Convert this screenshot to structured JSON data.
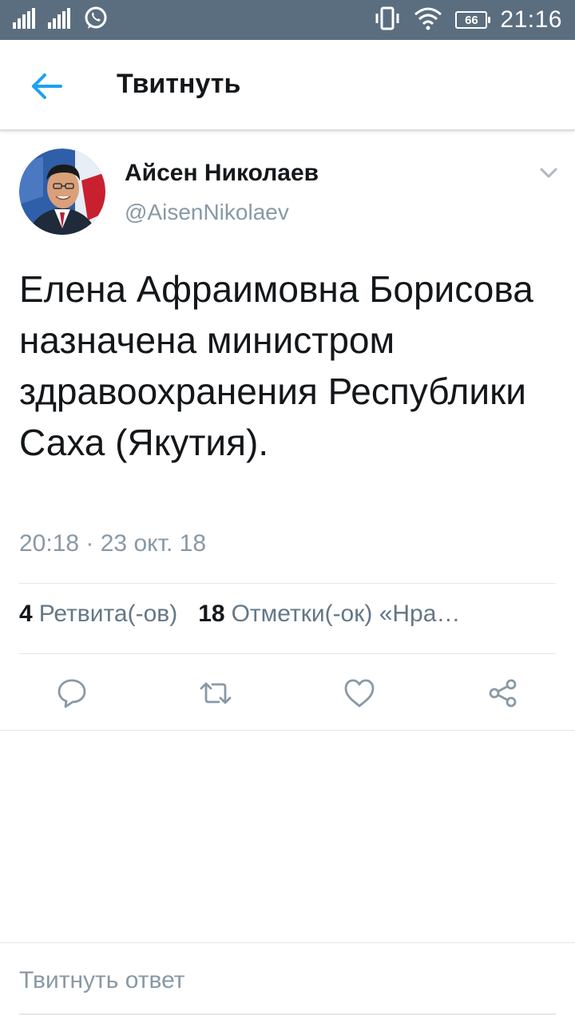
{
  "status_bar": {
    "time": "21:16",
    "battery": "66",
    "icons": [
      "signal-icon",
      "signal-icon",
      "whatsapp-icon",
      "vibrate-icon",
      "wifi-icon",
      "battery-icon"
    ]
  },
  "header": {
    "title": "Твитнуть",
    "back_icon": "arrow-left-icon",
    "accent": "#1da1f2"
  },
  "tweet": {
    "author_name": "Айсен Николаев",
    "author_handle": "@AisenNikolaev",
    "text": "Елена Афраимовна Борисова назначена министром здравоохранения Республики Саха (Якутия).",
    "timestamp": "20:18 · 23 окт. 18",
    "retweets_count": "4",
    "retweets_label": "Ретвита(-ов)",
    "likes_count": "18",
    "likes_label": "Отметки(-ок) «Нра…"
  },
  "actions": {
    "icons": [
      "reply-icon",
      "retweet-icon",
      "like-icon",
      "share-icon"
    ]
  },
  "reply": {
    "placeholder": "Твитнуть ответ"
  }
}
